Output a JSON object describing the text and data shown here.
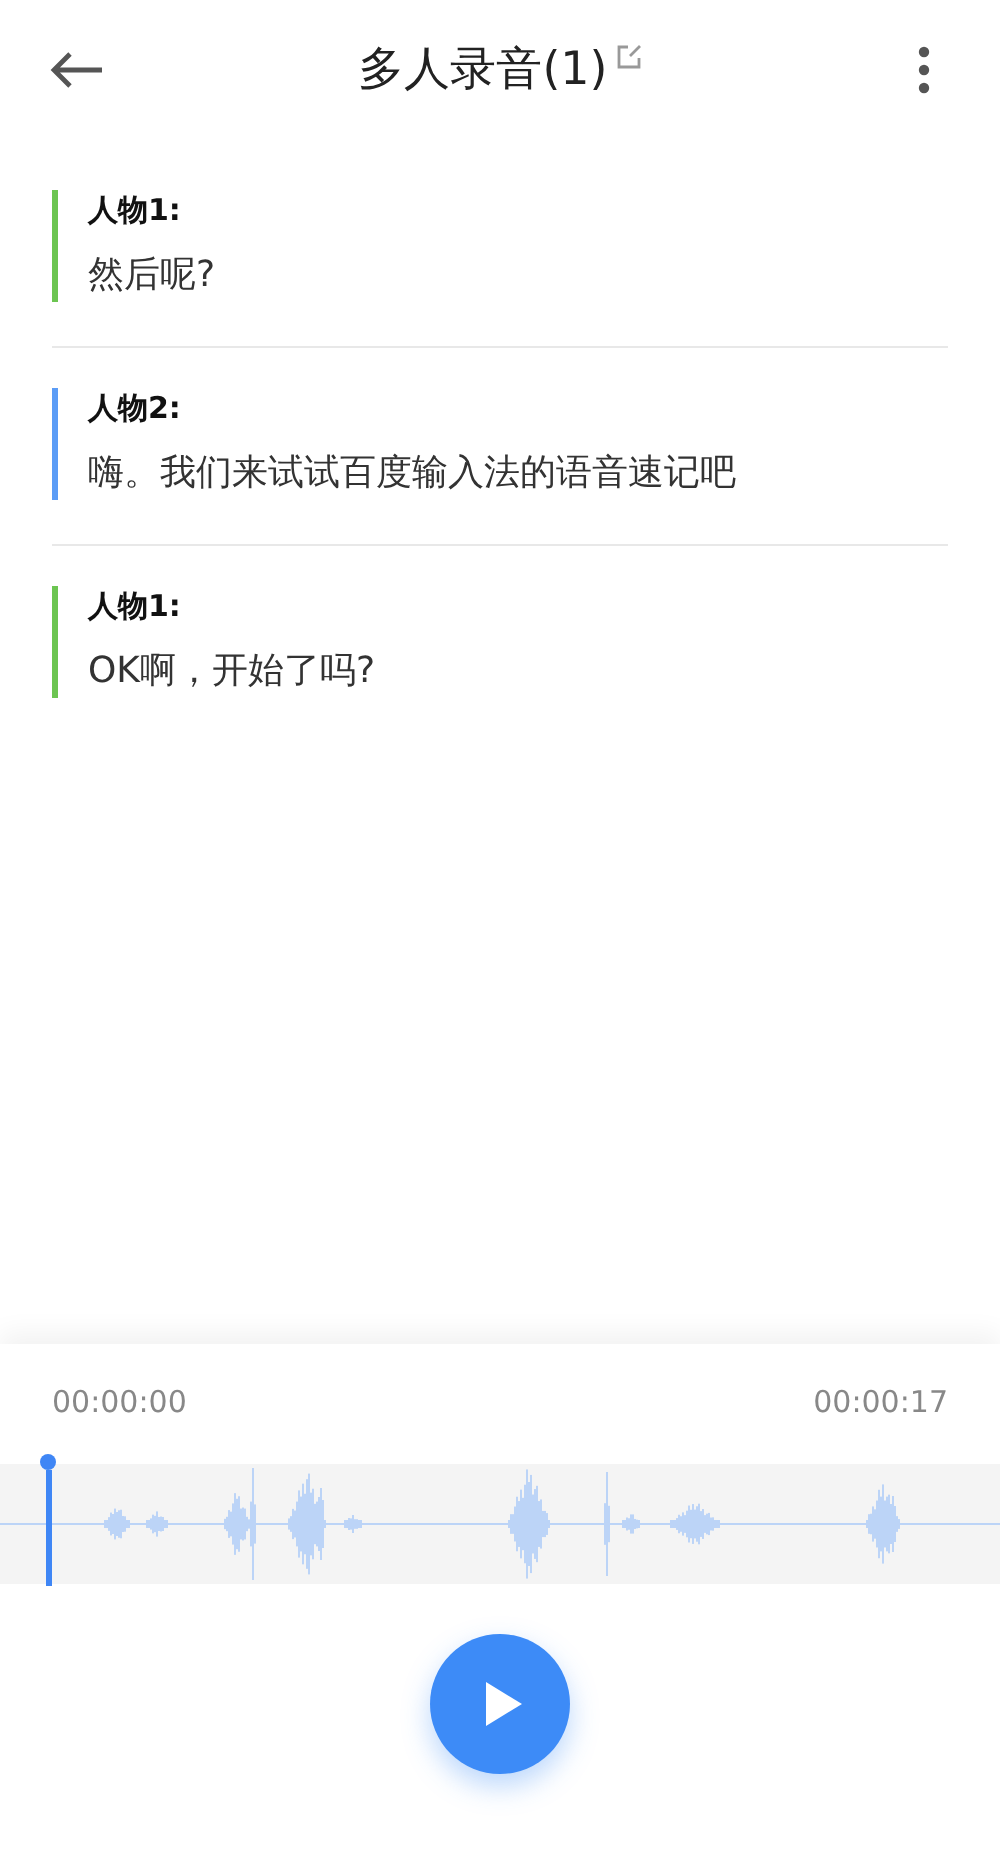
{
  "header": {
    "title": "多人录音(1)"
  },
  "transcript": [
    {
      "speaker": "人物1:",
      "text": "然后呢?",
      "color": "#6cc551"
    },
    {
      "speaker": "人物2:",
      "text": "嗨。我们来试试百度输入法的语音速记吧",
      "color": "#5b9cf6"
    },
    {
      "speaker": "人物1:",
      "text": "OK啊，开始了吗?",
      "color": "#6cc551"
    }
  ],
  "player": {
    "current_time": "00:00:00",
    "total_time": "00:00:17"
  }
}
